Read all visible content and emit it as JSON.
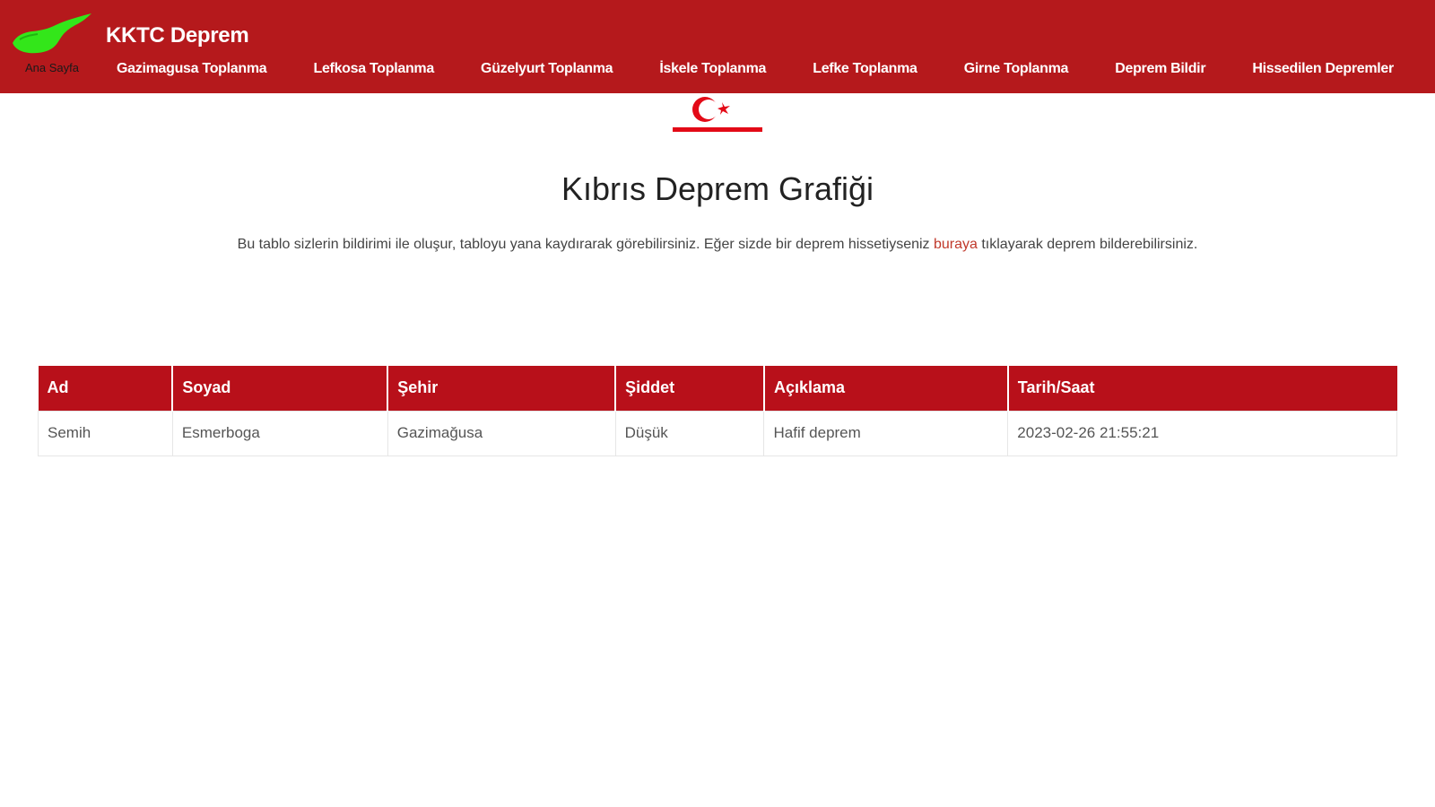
{
  "navbar": {
    "home_label": "Ana Sayfa",
    "brand": "KKTC Deprem",
    "links": [
      "Gazimagusa Toplanma",
      "Lefkosa Toplanma",
      "Güzelyurt Toplanma",
      "İskele Toplanma",
      "Lefke Toplanma",
      "Girne Toplanma",
      "Deprem Bildir",
      "Hissedilen Depremler"
    ]
  },
  "main": {
    "title": "Kıbrıs Deprem Grafiği",
    "intro_before": "Bu tablo sizlerin bildirimi ile oluşur, tabloyu yana kaydırarak görebilirsiniz. Eğer sizde bir deprem hissetiyseniz ",
    "intro_link": "buraya",
    "intro_after": " tıklayarak deprem bilderebilirsiniz."
  },
  "table": {
    "headers": [
      "Ad",
      "Soyad",
      "Şehir",
      "Şiddet",
      "Açıklama",
      "Tarih/Saat"
    ],
    "rows": [
      [
        "Semih",
        "Esmerboga",
        "Gazimağusa",
        "Düşük",
        "Hafif deprem",
        "2023-02-26 21:55:21"
      ]
    ]
  },
  "colors": {
    "navbar_bg": "#b5191c",
    "table_header_bg": "#b8101a",
    "link_accent": "#c0392b",
    "island_logo": "#33e61a"
  },
  "icons": {
    "logo": "cyprus-island-icon",
    "flag": "trnc-flag-icon"
  }
}
